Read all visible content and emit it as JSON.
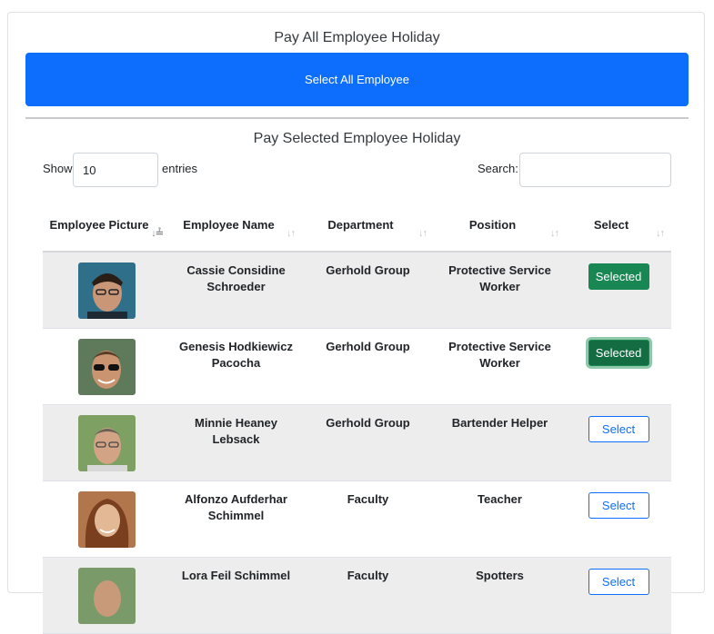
{
  "header": {
    "title": "Pay All Employee Holiday",
    "select_all_label": "Select All Employee",
    "subtitle": "Pay Selected Employee Holiday"
  },
  "controls": {
    "show_label": "Show",
    "entries_value": "10",
    "entries_label": "entries",
    "search_label": "Search:",
    "search_value": ""
  },
  "table": {
    "columns": [
      "Employee Picture",
      "Employee Name",
      "Department",
      "Position",
      "Select"
    ],
    "rows": [
      {
        "name": "Cassie Considine Schroeder",
        "department": "Gerhold Group",
        "position": "Protective Service Worker",
        "action": "Selected"
      },
      {
        "name": "Genesis Hodkiewicz Pacocha",
        "department": "Gerhold Group",
        "position": "Protective Service Worker",
        "action": "Selected"
      },
      {
        "name": "Minnie Heaney Lebsack",
        "department": "Gerhold Group",
        "position": "Bartender Helper",
        "action": "Select"
      },
      {
        "name": "Alfonzo Aufderhar Schimmel",
        "department": "Faculty",
        "position": "Teacher",
        "action": "Select"
      },
      {
        "name": "Lora Feil Schimmel",
        "department": "Faculty",
        "position": "Spotters",
        "action": "Select"
      }
    ]
  },
  "colors": {
    "primary": "#0d6efd",
    "success": "#198754",
    "stripe": "#ededed"
  }
}
